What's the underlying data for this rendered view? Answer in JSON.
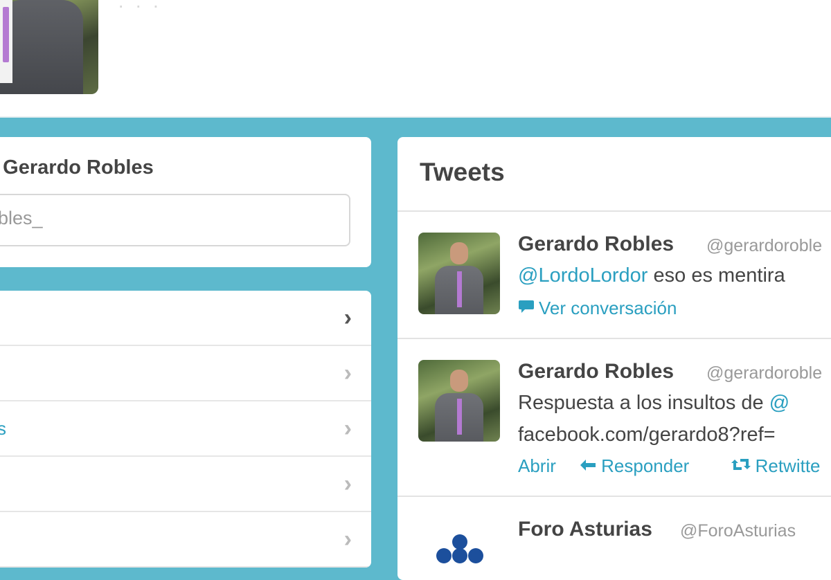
{
  "header": {
    "faint_text": "· · ·"
  },
  "follow": {
    "title": "a Gerardo Robles",
    "input_value": "obles_"
  },
  "nav": {
    "items": [
      {
        "label": "",
        "active": true
      },
      {
        "label": "",
        "active": false
      },
      {
        "label": "s",
        "active": false
      },
      {
        "label": "",
        "active": false
      },
      {
        "label": "",
        "active": false
      }
    ],
    "chevron": "›"
  },
  "tweets": {
    "heading": "Tweets",
    "items": [
      {
        "name": "Gerardo Robles",
        "handle": "@gerardoroble",
        "mention": "@LordoLordor",
        "text": " eso es mentira",
        "conversation": "Ver conversación"
      },
      {
        "name": "Gerardo Robles",
        "handle": "@gerardoroble",
        "text_prefix": "Respuesta a los insultos de ",
        "text_suffix": "@",
        "link": "facebook.com/gerardo8?ref=",
        "actions": {
          "open": "Abrir",
          "reply": "Responder",
          "retweet": "Retwitte"
        }
      },
      {
        "name": "Foro Asturias",
        "handle": "@ForoAsturias"
      }
    ]
  },
  "colors": {
    "background": "#5db9cd",
    "link": "#2a9fc0",
    "logo": "#1c4f9c"
  },
  "icons": {
    "conversation": "speech-bubble-icon",
    "reply": "reply-arrow-icon",
    "retweet": "retweet-icon"
  }
}
